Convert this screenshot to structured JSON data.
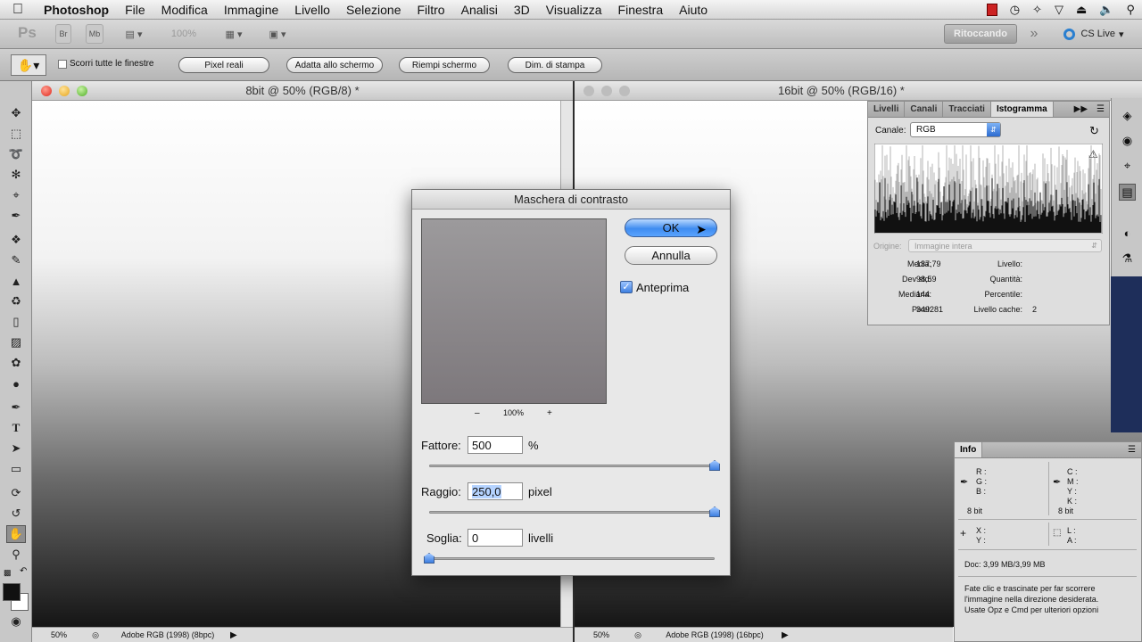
{
  "menubar": {
    "items": [
      "Photoshop",
      "File",
      "Modifica",
      "Immagine",
      "Livello",
      "Selezione",
      "Filtro",
      "Analisi",
      "3D",
      "Visualizza",
      "Finestra",
      "Aiuto"
    ]
  },
  "appbar": {
    "logo": "Ps",
    "br": "Br",
    "mb": "Mb",
    "zoom": "100%",
    "workspace": "Ritoccando",
    "more": "»",
    "cslive": "CS Live"
  },
  "optionsbar": {
    "scroll_all_label": "Scorri tutte le finestre",
    "buttons": [
      "Pixel reali",
      "Adatta allo schermo",
      "Riempi schermo",
      "Dim. di stampa"
    ]
  },
  "doc1": {
    "title": "8bit @ 50% (RGB/8) *",
    "zoom": "50%",
    "profile": "Adobe RGB (1998) (8bpc)"
  },
  "doc2": {
    "title": "16bit @ 50% (RGB/16) *",
    "zoom": "50%",
    "profile": "Adobe RGB (1998) (16bpc)"
  },
  "dialog": {
    "title": "Maschera di contrasto",
    "ok": "OK",
    "cancel": "Annulla",
    "preview_label": "Anteprima",
    "preview_checked": true,
    "zoom_minus": "–",
    "zoom_value": "100%",
    "zoom_plus": "+",
    "amount": {
      "label": "Fattore:",
      "value": "500",
      "unit": "%",
      "slider_level": 1.0
    },
    "radius": {
      "label": "Raggio:",
      "value": "250,0",
      "unit": "pixel",
      "slider_level": 1.0
    },
    "threshold": {
      "label": "Soglia:",
      "value": "0",
      "unit": "livelli",
      "slider_level": 0.0
    }
  },
  "histogram_panel": {
    "tabs": [
      "Livelli",
      "Canali",
      "Tracciati",
      "Istogramma"
    ],
    "active_tab": "Istogramma",
    "channel_label": "Canale:",
    "channel_value": "RGB",
    "source_label": "Origine:",
    "source_value": "Immagine intera",
    "stats_left": [
      {
        "label": "Media:",
        "value": "137,79"
      },
      {
        "label": "Dev std:",
        "value": "98,59"
      },
      {
        "label": "Mediana:",
        "value": "144"
      },
      {
        "label": "Pixel:",
        "value": "349281"
      }
    ],
    "stats_right": [
      {
        "label": "Livello:",
        "value": ""
      },
      {
        "label": "Quantità:",
        "value": ""
      },
      {
        "label": "Percentile:",
        "value": ""
      },
      {
        "label": "Livello cache:",
        "value": "2"
      }
    ]
  },
  "info_panel": {
    "tab": "Info",
    "rgb_labels": [
      "R :",
      "G :",
      "B :"
    ],
    "cmyk_labels": [
      "C :",
      "M :",
      "Y :",
      "K :"
    ],
    "bits_left": "8 bit",
    "bits_right": "8 bit",
    "xy_labels": [
      "X :",
      "Y :"
    ],
    "la_labels": [
      "L :",
      "A :"
    ],
    "doc_info": "Doc: 3,99 MB/3,99 MB",
    "hint_lines": [
      "Fate clic e trascinate per far scorrere",
      "l'immagine nella direzione desiderata.",
      "Usate Opz e Cmd per ulteriori opzioni"
    ]
  }
}
